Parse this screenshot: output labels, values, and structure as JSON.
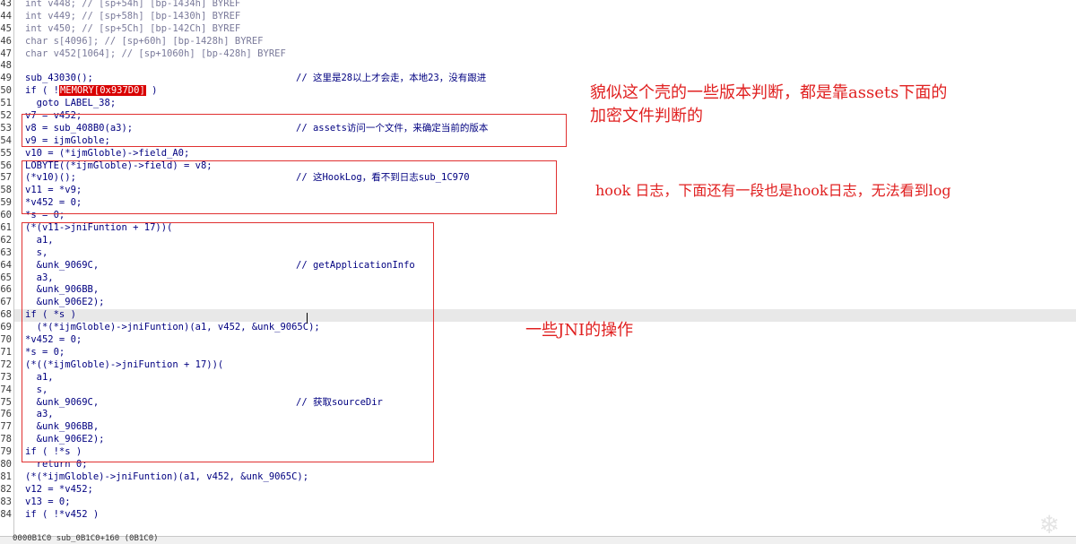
{
  "code_view": {
    "line_numbers": [
      "43",
      "44",
      "45",
      "46",
      "47",
      "48",
      "49",
      "50",
      "51",
      "52",
      "53",
      "54",
      "55",
      "56",
      "57",
      "58",
      "59",
      "60",
      "61",
      "62",
      "63",
      "64",
      "65",
      "66",
      "67",
      "68",
      "69",
      "70",
      "71",
      "72",
      "73",
      "74",
      "75",
      "76",
      "77",
      "78",
      "79",
      "80",
      "81",
      "82",
      "83",
      "84"
    ],
    "lines": [
      {
        "code": "int v448; // [sp+54h] [bp-1434h] BYREF",
        "comment": ""
      },
      {
        "code": "int v449; // [sp+58h] [bp-1430h] BYREF",
        "comment": ""
      },
      {
        "code": "int v450; // [sp+5Ch] [bp-142Ch] BYREF",
        "comment": ""
      },
      {
        "code": "char s[4096]; // [sp+60h] [bp-1428h] BYREF",
        "comment": ""
      },
      {
        "code": "char v452[1064]; // [sp+1060h] [bp-428h] BYREF",
        "comment": ""
      },
      {
        "code": "",
        "comment": ""
      },
      {
        "code": "sub_43030();",
        "comment": "// 这里是28以上才会走，本地23，没有跟进"
      },
      {
        "code": "if ( !MEMORY[0x937D0] )",
        "comment": ""
      },
      {
        "code": "  goto LABEL_38;",
        "comment": ""
      },
      {
        "code": "v7 = v452;",
        "comment": ""
      },
      {
        "code": "v8 = sub_408B0(a3);",
        "comment": "// assets访问一个文件，来确定当前的版本"
      },
      {
        "code": "v9 = ijmGloble;",
        "comment": ""
      },
      {
        "code": "v10 = (*ijmGloble)->field_A0;",
        "comment": ""
      },
      {
        "code": "LOBYTE((*ijmGloble)->field) = v8;",
        "comment": ""
      },
      {
        "code": "(*v10)();",
        "comment": "// 这HookLog，看不到日志sub_1C970"
      },
      {
        "code": "v11 = *v9;",
        "comment": ""
      },
      {
        "code": "*v452 = 0;",
        "comment": ""
      },
      {
        "code": "*s = 0;",
        "comment": ""
      },
      {
        "code": "(*(v11->jniFuntion + 17))(",
        "comment": ""
      },
      {
        "code": "  a1,",
        "comment": ""
      },
      {
        "code": "  s,",
        "comment": ""
      },
      {
        "code": "  &unk_9069C,",
        "comment": "// getApplicationInfo"
      },
      {
        "code": "  a3,",
        "comment": ""
      },
      {
        "code": "  &unk_906BB,",
        "comment": ""
      },
      {
        "code": "  &unk_906E2);",
        "comment": ""
      },
      {
        "code": "if ( *s )",
        "comment": ""
      },
      {
        "code": "  (*(*ijmGloble)->jniFuntion)(a1, v452, &unk_9065C);",
        "comment": ""
      },
      {
        "code": "*v452 = 0;",
        "comment": ""
      },
      {
        "code": "*s = 0;",
        "comment": ""
      },
      {
        "code": "(*((*ijmGloble)->jniFuntion + 17))(",
        "comment": ""
      },
      {
        "code": "  a1,",
        "comment": ""
      },
      {
        "code": "  s,",
        "comment": ""
      },
      {
        "code": "  &unk_9069C,",
        "comment": "// 获取sourceDir"
      },
      {
        "code": "  a3,",
        "comment": ""
      },
      {
        "code": "  &unk_906BB,",
        "comment": ""
      },
      {
        "code": "  &unk_906E2);",
        "comment": ""
      },
      {
        "code": "if ( !*s )",
        "comment": ""
      },
      {
        "code": "  return 0;",
        "comment": ""
      },
      {
        "code": "(*(*ijmGloble)->jniFuntion)(a1, v452, &unk_9065C);",
        "comment": ""
      },
      {
        "code": "v12 = *v452;",
        "comment": ""
      },
      {
        "code": "v13 = 0;",
        "comment": ""
      },
      {
        "code": "if ( !*v452 )",
        "comment": ""
      }
    ]
  },
  "annotations": {
    "note1_line1": "貌似这个壳的一些版本判断，都是靠assets下面的",
    "note1_line2": "加密文件判断的",
    "note2": "hook 日志，下面还有一段也是hook日志，无法看到log",
    "note3": "一些JNI的操作"
  },
  "status_bar": {
    "text": "0000B1C0 sub_0B1C0+160 (0B1C0)"
  },
  "colors": {
    "annotation_red": "#e02020",
    "memory_highlight": "#d90000",
    "code_text": "#000080"
  }
}
